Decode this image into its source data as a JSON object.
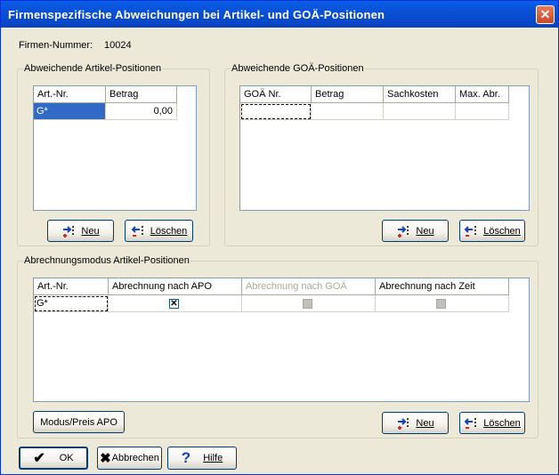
{
  "window": {
    "title": "Firmenspezifische Abweichungen bei Artikel- und GOÄ-Positionen"
  },
  "firma": {
    "label": "Firmen-Nummer:",
    "value": "10024"
  },
  "artikel": {
    "legend": "Abweichende Artikel-Positionen",
    "headers": [
      "Art.-Nr.",
      "Betrag"
    ],
    "row": [
      "G*",
      "0,00"
    ],
    "new_label": "Neu",
    "delete_label": "Löschen"
  },
  "goae": {
    "legend": "Abweichende GOÄ-Positionen",
    "headers": [
      "GOÄ Nr.",
      "Betrag",
      "Sachkosten",
      "Max. Abr."
    ],
    "new_label": "Neu",
    "delete_label": "Löschen"
  },
  "modus": {
    "legend": "Abrechnungsmodus Artikel-Positionen",
    "headers": [
      "Art.-Nr.",
      "Abrechnung nach APO",
      "Abrechnung nach GOÄ",
      "Abrechnung nach Zeit"
    ],
    "row_art": "G*",
    "apo_checked": true,
    "goae_checked": false,
    "zeit_checked": false,
    "modus_button": "Modus/Preis APO",
    "new_label": "Neu",
    "delete_label": "Löschen"
  },
  "footer": {
    "ok_label": "OK",
    "cancel_label": "Abbrechen",
    "help_label": "Hilfe"
  }
}
